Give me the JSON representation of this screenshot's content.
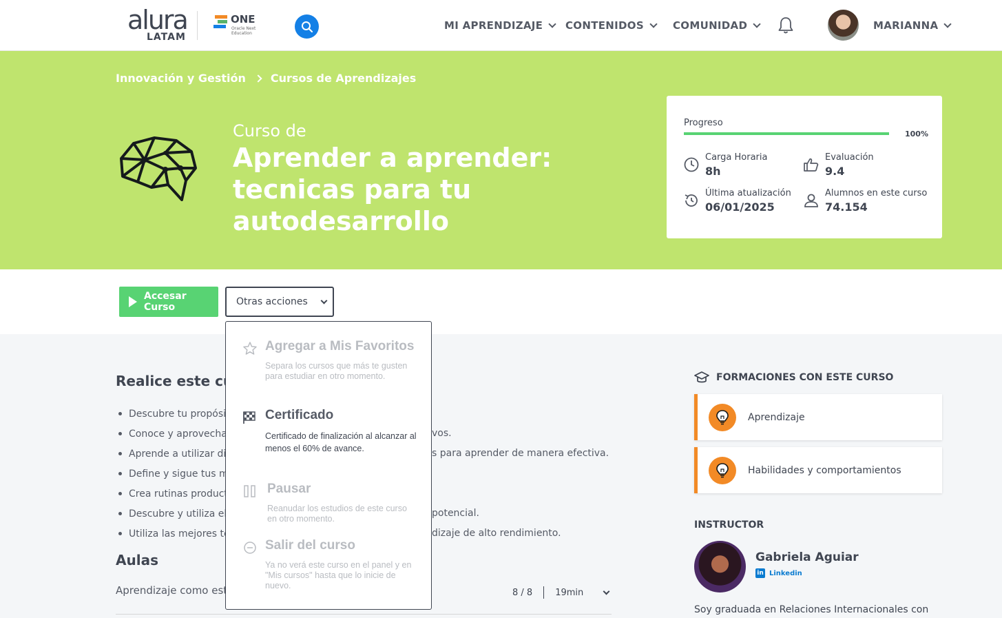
{
  "brand": {
    "logo_main": "alura",
    "logo_sub": "LATAM",
    "partner_name": "ONE",
    "partner_sub": "Oracle Next Education"
  },
  "nav": {
    "items": [
      "MI APRENDIZAJE",
      "CONTENIDOS",
      "COMUNIDAD"
    ],
    "user_name": "MARIANNA",
    "search_icon": "search-icon",
    "bell_icon": "bell-icon"
  },
  "breadcrumb": [
    "Innovación y Gestión",
    "Cursos de Aprendizajes"
  ],
  "course": {
    "pre_title": "Curso de",
    "title": "Aprender a aprender: tecnicas para tu autodesarrollo",
    "icon": "brain-icon"
  },
  "stats": {
    "progress_label": "Progreso",
    "progress_value": 100,
    "progress_text": "100%",
    "workload_label": "Carga Horaria",
    "workload_value": "8h",
    "rating_label": "Evaluación",
    "rating_value": "9.4",
    "updated_label": "Última atualización",
    "updated_value": "06/01/2025",
    "students_label": "Alumnos en este curso",
    "students_value": "74.154"
  },
  "actions": {
    "access_label": "Accesar Curso",
    "more_label": "Otras acciones"
  },
  "dropdown": {
    "favorite_title": "Agregar a Mis Favoritos",
    "favorite_desc": "Separa los cursos que más te gusten para estudiar en otro momento.",
    "certificate_title": "Certificado",
    "certificate_desc": "Certificado de finalización al alcanzar al menos el 60% de avance.",
    "pause_title": "Pausar",
    "pause_desc": "Reanudar los estudios de este curso en otro momento.",
    "leave_title": "Salir del curso",
    "leave_desc": "Ya no verá este curso en el panel y en \"Mis cursos\" hasta que lo inicie de nuevo."
  },
  "main": {
    "goals_title": "Realice este curs",
    "goals": [
      "Descubre tu propósit",
      "Conoce y aprovecha t",
      "Aprende a utilizar dife",
      "Define y sigue tus me",
      "Crea rutinas productiv",
      "Descubre y utiliza el p",
      "Utiliza las mejores téc"
    ],
    "goals_tail": [
      "",
      "vos.",
      "s para aprender de manera efectiva.",
      "",
      "",
      "potencial.",
      "dizaje de alto rendimiento."
    ],
    "lessons_title": "Aulas",
    "lesson": {
      "name": "Aprendizaje como est",
      "progress": "8 / 8",
      "duration": "19min"
    }
  },
  "sidebar": {
    "formations_title": "FORMACIONES CON ESTE CURSO",
    "formations": [
      "Aprendizaje",
      "Habilidades y comportamientos"
    ],
    "instructor_title": "INSTRUCTOR",
    "instructor_name": "Gabriela Aguiar",
    "linkedin_label": "Linkedin",
    "instructor_bio": "Soy graduada en Relaciones Internacionales con"
  },
  "colors": {
    "hero": "#bfe46e",
    "accent_green": "#58d373",
    "formation_orange": "#f28a26",
    "search_blue": "#1480e6"
  }
}
